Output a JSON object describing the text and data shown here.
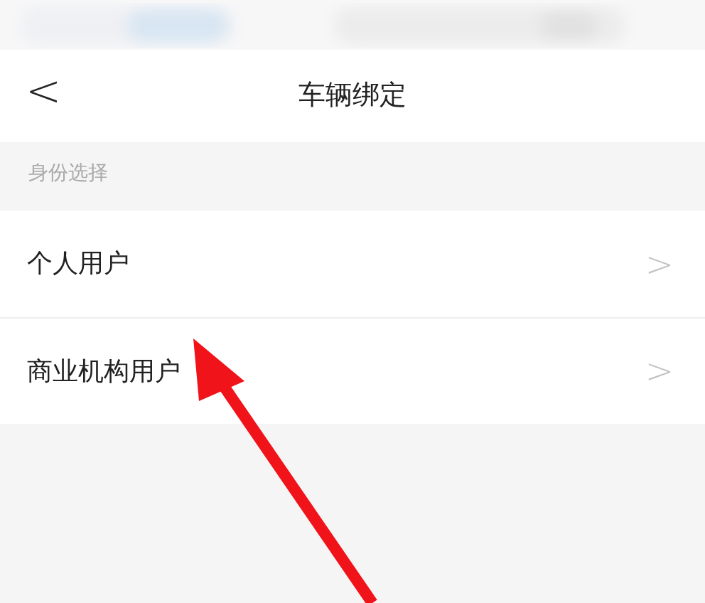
{
  "header": {
    "back": "<",
    "title": "车辆绑定"
  },
  "section": {
    "label": "身份选择"
  },
  "options": [
    {
      "label": "个人用户",
      "chevron": ">"
    },
    {
      "label": "商业机构用户",
      "chevron": ">"
    }
  ],
  "annotation": {
    "kind": "arrow"
  }
}
